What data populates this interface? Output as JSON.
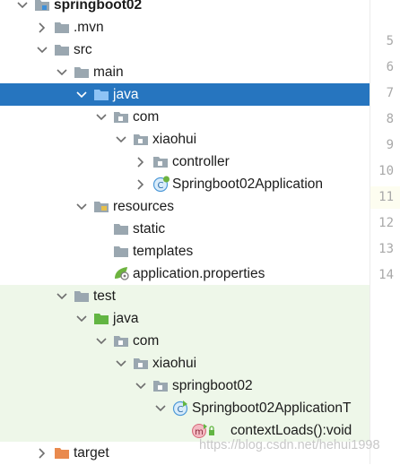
{
  "tree": [
    {
      "label": "springboot02",
      "depth": 0,
      "arrow": "down",
      "icon": "module",
      "bold": true
    },
    {
      "label": ".mvn",
      "depth": 1,
      "arrow": "right",
      "icon": "folder"
    },
    {
      "label": "src",
      "depth": 1,
      "arrow": "down",
      "icon": "folder"
    },
    {
      "label": "main",
      "depth": 2,
      "arrow": "down",
      "icon": "folder"
    },
    {
      "label": "java",
      "depth": 3,
      "arrow": "down",
      "icon": "folder-source",
      "selected": true
    },
    {
      "label": "com",
      "depth": 4,
      "arrow": "down",
      "icon": "package"
    },
    {
      "label": "xiaohui",
      "depth": 5,
      "arrow": "down",
      "icon": "package"
    },
    {
      "label": "controller",
      "depth": 6,
      "arrow": "right",
      "icon": "package"
    },
    {
      "label": "Springboot02Application",
      "depth": 6,
      "arrow": "right",
      "icon": "spring-class"
    },
    {
      "label": "resources",
      "depth": 3,
      "arrow": "down",
      "icon": "folder-resources"
    },
    {
      "label": "static",
      "depth": 4,
      "arrow": "none",
      "icon": "folder"
    },
    {
      "label": "templates",
      "depth": 4,
      "arrow": "none",
      "icon": "folder"
    },
    {
      "label": "application.properties",
      "depth": 4,
      "arrow": "none",
      "icon": "spring-properties"
    },
    {
      "label": "test",
      "depth": 2,
      "arrow": "down",
      "icon": "folder",
      "test": true
    },
    {
      "label": "java",
      "depth": 3,
      "arrow": "down",
      "icon": "folder-test",
      "test": true
    },
    {
      "label": "com",
      "depth": 4,
      "arrow": "down",
      "icon": "package",
      "test": true
    },
    {
      "label": "xiaohui",
      "depth": 5,
      "arrow": "down",
      "icon": "package",
      "test": true
    },
    {
      "label": "springboot02",
      "depth": 6,
      "arrow": "down",
      "icon": "package",
      "test": true
    },
    {
      "label": "Springboot02ApplicationT",
      "depth": 7,
      "arrow": "down",
      "icon": "test-class",
      "test": true
    },
    {
      "label": "contextLoads():void",
      "depth": 8,
      "arrow": "none",
      "icon": "method",
      "test": true
    },
    {
      "label": "target",
      "depth": 1,
      "arrow": "right",
      "icon": "folder-excluded"
    }
  ],
  "line_numbers": [
    "5",
    "6",
    "7",
    "8",
    "9",
    "10",
    "11",
    "12",
    "13",
    "14"
  ],
  "current_line": "11",
  "watermark": "https://blog.csdn.net/hehui1998",
  "colors": {
    "selection": "#2675bf",
    "test_bg": "#eef7e9",
    "folder": "#9aa7b0",
    "source": "#3d8fd8",
    "test_folder": "#62b543",
    "resources": "#9aa7b0",
    "excluded": "#e98a4e",
    "spring": "#6db33f"
  }
}
